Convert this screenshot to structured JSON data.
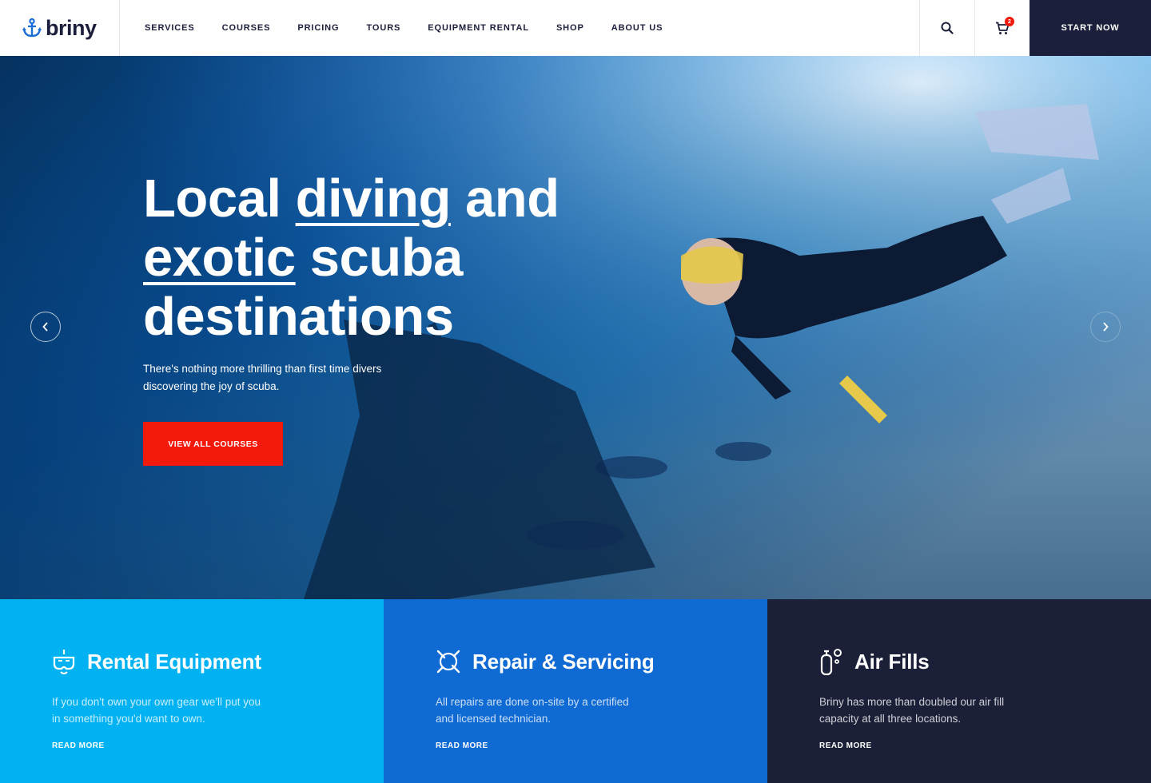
{
  "brand": {
    "name": "briny",
    "logo_icon": "anchor-icon",
    "accent": "#1a6fd6"
  },
  "nav": {
    "items": [
      {
        "label": "SERVICES"
      },
      {
        "label": "COURSES"
      },
      {
        "label": "PRICING"
      },
      {
        "label": "TOURS"
      },
      {
        "label": "EQUIPMENT RENTAL"
      },
      {
        "label": "SHOP"
      },
      {
        "label": "ABOUT US"
      }
    ]
  },
  "header": {
    "search_icon": "search-icon",
    "cart_icon": "cart-icon",
    "cart_count": "2",
    "cta_label": "START NOW",
    "cta_color": "#1b1f3b"
  },
  "hero": {
    "title_line1_word1": "Local",
    "title_line1_word2": "diving",
    "title_line1_word3": "and",
    "title_line2_word1": "exotic",
    "title_line2_word2": "scuba",
    "title_line3": "destinations",
    "subtitle_line1": "There's nothing more thrilling than first  time divers",
    "subtitle_line2": "discovering the joy of scuba.",
    "cta_label": "VIEW ALL COURSES",
    "cta_color": "#f31a0b",
    "prev_icon": "chevron-left-icon",
    "next_icon": "chevron-right-icon"
  },
  "features": [
    {
      "icon": "snorkel-mask-icon",
      "title": "Rental Equipment",
      "text_line1": "If you don't own your own gear we'll put you",
      "text_line2": "in something you'd want to own.",
      "link": "READ MORE",
      "color": "#00b2f2"
    },
    {
      "icon": "repair-tools-icon",
      "title": "Repair & Servicing",
      "text_line1": "All repairs are done on-site by a certified",
      "text_line2": "and licensed technician.",
      "link": "READ MORE",
      "color": "#0f6ad4"
    },
    {
      "icon": "air-tank-icon",
      "title": "Air Fills",
      "text_line1": "Briny has more than doubled our air fill",
      "text_line2": "capacity at all three locations.",
      "link": "READ MORE",
      "color": "#1b1f38"
    }
  ]
}
